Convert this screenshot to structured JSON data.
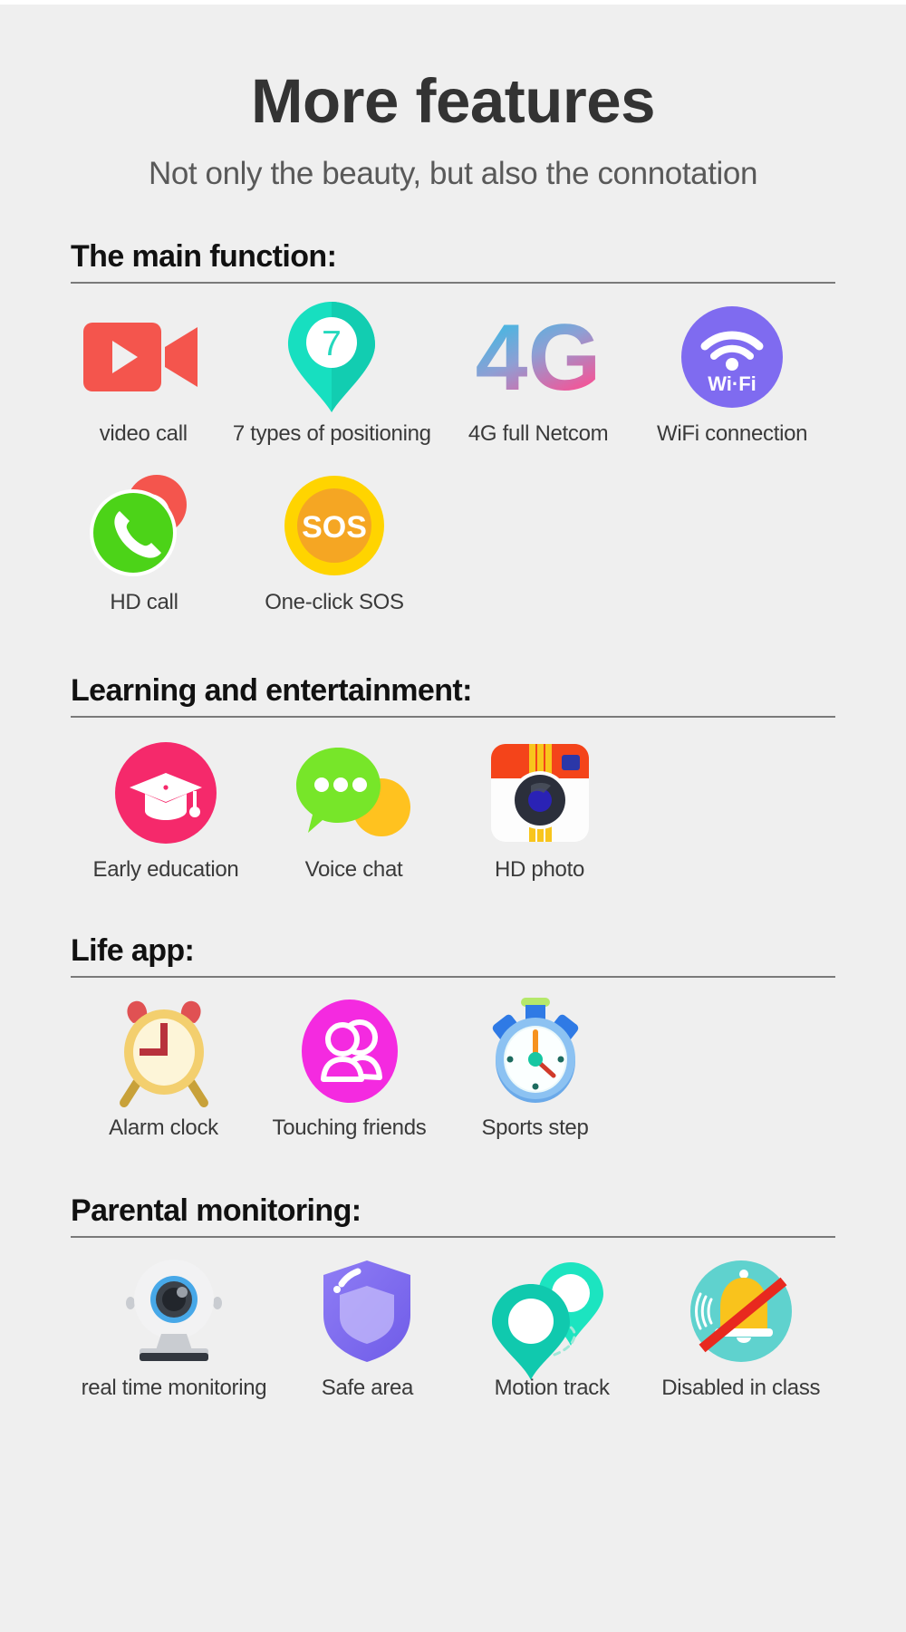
{
  "header": {
    "title": "More features",
    "subtitle": "Not only the beauty, but also the connotation"
  },
  "colors": {
    "background": "#efefef",
    "title": "#333333",
    "subtitle": "#595959",
    "rule": "#7a7a7a",
    "video_red": "#f4554d",
    "pin_teal": "#1fe0c0",
    "4g_gradient_start": "#22c8e8",
    "4g_gradient_end": "#f74f8e",
    "wifi_purple": "#7f6bf0",
    "phone_green": "#4cd318",
    "hangup_red": "#f4554d",
    "sos_yellow": "#ffd400",
    "sos_orange": "#f5a623",
    "education_pink": "#f5296b",
    "chat_green": "#77e629",
    "chat_yellow": "#ffc21f",
    "camera_orange": "#f4441a",
    "camera_stripe": "#f8c51c",
    "clock_yellow": "#f3cf6e",
    "clock_bell_red": "#e05153",
    "friends_magenta": "#f42ae0",
    "stopwatch_blue": "#4a90e2",
    "webcam_blue": "#47a8e8",
    "shield_purple": "#8878f2",
    "track_teal": "#10c9ae",
    "disabled_teal": "#5fd2ce",
    "bell_yellow": "#f9c31c",
    "ban_red": "#e8291f"
  },
  "sections": [
    {
      "id": "main-function",
      "title": "The main function:",
      "rows": [
        {
          "items": [
            {
              "label": "video call",
              "icon": "video-camera-icon"
            },
            {
              "label": "7 types of positioning",
              "icon": "map-pin-seven-icon",
              "badge": "7"
            },
            {
              "label": "4G full Netcom",
              "icon": "four-g-icon",
              "text": "4G"
            },
            {
              "label": "WiFi connection",
              "icon": "wifi-icon",
              "text": "Wi·Fi"
            }
          ]
        },
        {
          "items": [
            {
              "label": "HD call",
              "icon": "phone-call-icon"
            },
            {
              "label": "One-click SOS",
              "icon": "sos-icon",
              "text": "SOS"
            }
          ]
        }
      ]
    },
    {
      "id": "learning-entertainment",
      "title": "Learning and entertainment:",
      "rows": [
        {
          "items": [
            {
              "label": "Early education",
              "icon": "graduation-cap-icon"
            },
            {
              "label": "Voice chat",
              "icon": "speech-bubbles-icon"
            },
            {
              "label": "HD photo",
              "icon": "retro-camera-icon"
            }
          ]
        }
      ]
    },
    {
      "id": "life-app",
      "title": "Life app:",
      "rows": [
        {
          "items": [
            {
              "label": "Alarm clock",
              "icon": "alarm-clock-icon"
            },
            {
              "label": "Touching friends",
              "icon": "two-people-icon"
            },
            {
              "label": "Sports step",
              "icon": "stopwatch-icon"
            }
          ]
        }
      ]
    },
    {
      "id": "parental-monitoring",
      "title": "Parental monitoring:",
      "rows": [
        {
          "items": [
            {
              "label": "real time monitoring",
              "icon": "webcam-icon"
            },
            {
              "label": "Safe area",
              "icon": "shield-icon"
            },
            {
              "label": "Motion track",
              "icon": "motion-track-pins-icon"
            },
            {
              "label": "Disabled in class",
              "icon": "bell-disabled-icon"
            }
          ]
        }
      ]
    }
  ]
}
